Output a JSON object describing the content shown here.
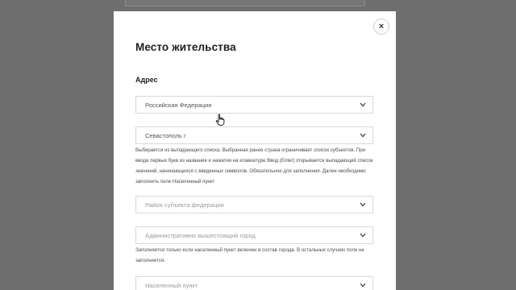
{
  "modal": {
    "title": "Место жительства",
    "close_glyph": "×",
    "section_title": "Адрес"
  },
  "fields": {
    "country": {
      "value": "Российская Федерация",
      "icon": "chevron-down-icon"
    },
    "subject": {
      "value": "Севастополь г",
      "icon": "chevron-down-icon"
    },
    "subject_help": "Выбирается из выпадающего списка. Выбранная ранее страна ограничивает список субъектов. При вводе первых букв из названия и нажатия на клавиатуре Ввод (Enter) открывается выпадающий список значений, начинающихся с введенных символов. Обязательное для заполнения. Далее необходимо заполнить поле Населенный пункт",
    "district": {
      "placeholder": "Район субъекта федерации",
      "icon": "chevron-down-icon"
    },
    "admin_city": {
      "placeholder": "Административно вышестоящий город",
      "icon": "chevron-down-icon"
    },
    "admin_city_help": "Заполняется только если населенный пункт включен в состав города. В остальных случаях поле не заполняется.",
    "locality": {
      "placeholder": "Населенный пункт",
      "icon": "chevron-down-icon"
    }
  },
  "colors": {
    "backdrop": "#6e6e6e",
    "modal_bg": "#ffffff",
    "border": "#d9d9d9",
    "accent_text": "#1e1e1e"
  }
}
